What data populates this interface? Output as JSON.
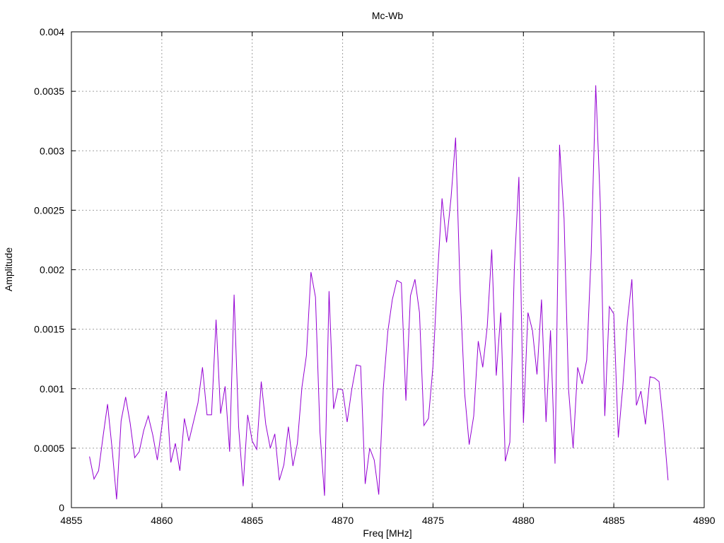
{
  "chart_data": {
    "type": "line",
    "title": "Mc-Wb",
    "xlabel": "Freq [MHz]",
    "ylabel": "Amplitude",
    "xlim": [
      4855,
      4890
    ],
    "ylim": [
      0,
      0.004
    ],
    "x_ticks": [
      "4855",
      "4860",
      "4865",
      "4870",
      "4875",
      "4880",
      "4885",
      "4890"
    ],
    "y_ticks": [
      "0",
      "0.0005",
      "0.001",
      "0.0015",
      "0.002",
      "0.0025",
      "0.003",
      "0.0035",
      "0.004"
    ],
    "grid": true,
    "line_color": "#9400d3",
    "series": [
      {
        "x": [
          4856.0,
          4856.25,
          4856.5,
          4856.75,
          4857.0,
          4857.25,
          4857.5,
          4857.75,
          4858.0,
          4858.25,
          4858.5,
          4858.75,
          4859.0,
          4859.25,
          4859.5,
          4859.75,
          4860.0,
          4860.25,
          4860.5,
          4860.75,
          4861.0,
          4861.25,
          4861.5,
          4861.75,
          4862.0,
          4862.25,
          4862.5,
          4862.75,
          4863.0,
          4863.25,
          4863.5,
          4863.75,
          4864.0,
          4864.25,
          4864.5,
          4864.75,
          4865.0,
          4865.25,
          4865.5,
          4865.75,
          4866.0,
          4866.25,
          4866.5,
          4866.75,
          4867.0,
          4867.25,
          4867.5,
          4867.75,
          4868.0,
          4868.25,
          4868.5,
          4868.75,
          4869.0,
          4869.25,
          4869.5,
          4869.75,
          4870.0,
          4870.25,
          4870.5,
          4870.75,
          4871.0,
          4871.25,
          4871.5,
          4871.75,
          4872.0,
          4872.25,
          4872.5,
          4872.75,
          4873.0,
          4873.25,
          4873.5,
          4873.75,
          4874.0,
          4874.25,
          4874.5,
          4874.75,
          4875.0,
          4875.25,
          4875.5,
          4875.75,
          4876.0,
          4876.25,
          4876.5,
          4876.75,
          4877.0,
          4877.25,
          4877.5,
          4877.75,
          4878.0,
          4878.25,
          4878.5,
          4878.75,
          4879.0,
          4879.25,
          4879.5,
          4879.75,
          4880.0,
          4880.25,
          4880.5,
          4880.75,
          4881.0,
          4881.25,
          4881.5,
          4881.75,
          4882.0,
          4882.25,
          4882.5,
          4882.75,
          4883.0,
          4883.25,
          4883.5,
          4883.75,
          4884.0,
          4884.25,
          4884.5,
          4884.75,
          4885.0,
          4885.25,
          4885.5,
          4885.75,
          4886.0,
          4886.25,
          4886.5,
          4886.75,
          4887.0,
          4887.25,
          4887.5,
          4887.75,
          4888.0
        ],
        "y": [
          0.00043,
          0.00024,
          0.00031,
          0.0006,
          0.00087,
          0.0005,
          7e-05,
          0.00073,
          0.00093,
          0.00071,
          0.00042,
          0.00047,
          0.00065,
          0.00077,
          0.00061,
          0.0004,
          0.00068,
          0.00098,
          0.00038,
          0.00054,
          0.00031,
          0.00075,
          0.00056,
          0.00072,
          0.00088,
          0.00118,
          0.00078,
          0.00078,
          0.00158,
          0.00079,
          0.00102,
          0.00047,
          0.00179,
          0.00068,
          0.00018,
          0.00078,
          0.00056,
          0.00049,
          0.00106,
          0.0007,
          0.0005,
          0.00062,
          0.00023,
          0.00036,
          0.00068,
          0.00035,
          0.00054,
          0.00101,
          0.00128,
          0.00198,
          0.00177,
          0.00063,
          0.0001,
          0.00182,
          0.00083,
          0.001,
          0.00099,
          0.00072,
          0.00099,
          0.0012,
          0.00119,
          0.0002,
          0.0005,
          0.0004,
          0.00011,
          0.001,
          0.00148,
          0.00175,
          0.00191,
          0.00189,
          0.0009,
          0.00178,
          0.00192,
          0.00164,
          0.00069,
          0.00075,
          0.00119,
          0.00195,
          0.0026,
          0.00223,
          0.00261,
          0.00311,
          0.00183,
          0.00096,
          0.00053,
          0.00077,
          0.0014,
          0.00118,
          0.00152,
          0.00217,
          0.00111,
          0.00164,
          0.00039,
          0.00055,
          0.00202,
          0.00278,
          0.00071,
          0.00164,
          0.00149,
          0.00112,
          0.00175,
          0.00072,
          0.00149,
          0.00037,
          0.00305,
          0.00243,
          0.00099,
          0.0005,
          0.00118,
          0.00104,
          0.00124,
          0.00214,
          0.00355,
          0.00256,
          0.00077,
          0.00169,
          0.00163,
          0.00059,
          0.00102,
          0.00156,
          0.00192,
          0.00086,
          0.00098,
          0.0007,
          0.0011,
          0.00109,
          0.00106,
          0.00069,
          0.00023
        ]
      }
    ]
  }
}
